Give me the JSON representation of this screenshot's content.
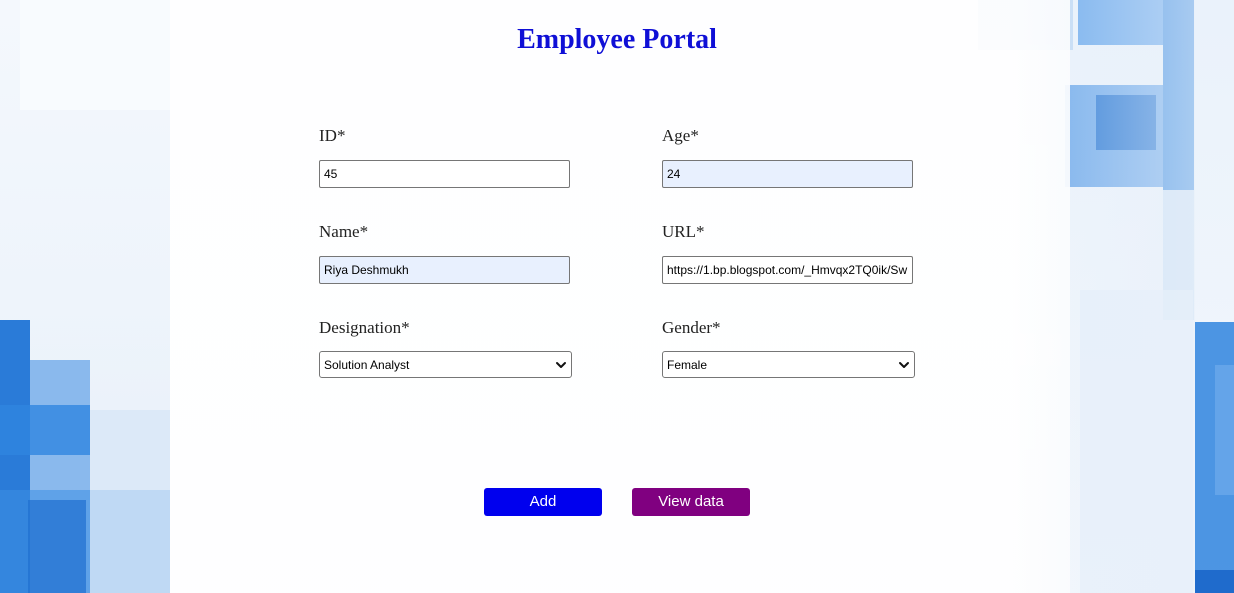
{
  "page": {
    "title": "Employee Portal"
  },
  "form": {
    "id": {
      "label": "ID*",
      "value": "45"
    },
    "age": {
      "label": "Age*",
      "value": "24"
    },
    "name": {
      "label": "Name*",
      "value": "Riya Deshmukh"
    },
    "url": {
      "label": "URL*",
      "value": "https://1.bp.blogspot.com/_Hmvqx2TQ0ik/Sw"
    },
    "designation": {
      "label": "Designation*",
      "selected": "Solution Analyst"
    },
    "gender": {
      "label": "Gender*",
      "selected": "Female"
    }
  },
  "actions": {
    "add_label": "Add",
    "view_label": "View data"
  },
  "colors": {
    "title": "#0f0fd6",
    "add_button": "#0000ee",
    "view_button": "#800080",
    "background_accent": "#2f7fdc"
  }
}
